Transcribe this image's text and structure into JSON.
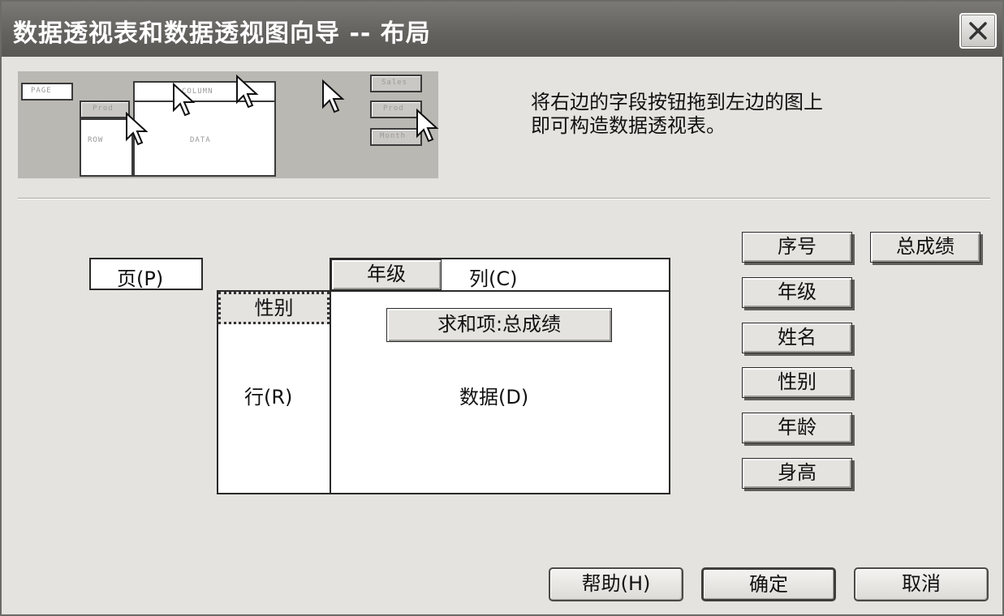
{
  "window": {
    "title": "数据透视表和数据透视图向导 -- 布局"
  },
  "preview": {
    "page_label": "PAGE",
    "column_label": "COLUMN",
    "row_label": "ROW",
    "data_label": "DATA",
    "prod_label": "Prod",
    "field_buttons": [
      "Sales",
      "Prod",
      "Month"
    ]
  },
  "instruction": {
    "line1": "将右边的字段按钮拖到左边的图上",
    "line2": "即可构造数据透视表。"
  },
  "layout": {
    "page_label": "页(P)",
    "column_label": "列(C)",
    "row_label": "行(R)",
    "data_label": "数据(D)",
    "column_field": "年级",
    "row_field": "性别",
    "data_field": "求和项:总成绩"
  },
  "fields": [
    "序号",
    "年级",
    "姓名",
    "性别",
    "年龄",
    "身高",
    "总成绩"
  ],
  "buttons": {
    "help": "帮助(H)",
    "ok": "确定",
    "cancel": "取消"
  }
}
